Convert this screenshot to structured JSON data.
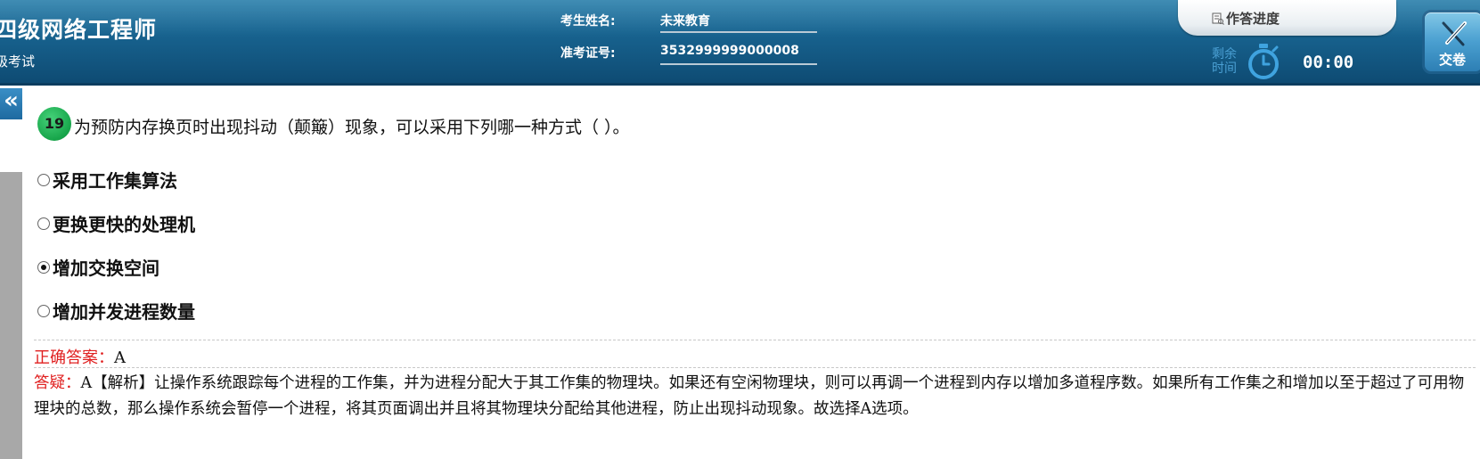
{
  "header": {
    "exam_title": "四级网络工程师",
    "exam_subtitle": "级考试",
    "candidate_name_label": "考生姓名:",
    "candidate_name": "未来教育",
    "ticket_no_label": "准考证号:",
    "ticket_no": "3532999999000008",
    "progress_tab_label": "作答进度",
    "remaining_time_label_1": "剩余",
    "remaining_time_label_2": "时间",
    "timer": "00:00",
    "submit_label": "交卷"
  },
  "sidebar": {
    "collapse_symbol": "«"
  },
  "question": {
    "number": "19",
    "text": "为预防内存换页时出现抖动（颠簸）现象，可以采用下列哪一种方式（  ）。",
    "options": [
      {
        "label": "采用工作集算法",
        "selected": false
      },
      {
        "label": "更换更快的处理机",
        "selected": false
      },
      {
        "label": "增加交换空间",
        "selected": true
      },
      {
        "label": "增加并发进程数量",
        "selected": false
      }
    ]
  },
  "answer": {
    "correct_label": "正确答案：",
    "correct_value": "A",
    "explain_label": "答疑：",
    "explain_text": "A【解析】让操作系统跟踪每个进程的工作集，并为进程分配大于其工作集的物理块。如果还有空闲物理块，则可以再调一个进程到内存以增加多道程序数。如果所有工作集之和增加以至于超过了可用物理块的总数，那么操作系统会暂停一个进程，将其页面调出并且将其物理块分配给其他进程，防止出现抖动现象。故选择A选项。"
  },
  "colors": {
    "header_bg": "#17618d",
    "badge_green": "#17a54a",
    "answer_red": "#e02020",
    "timer_label_blue": "#4a9fd3"
  }
}
